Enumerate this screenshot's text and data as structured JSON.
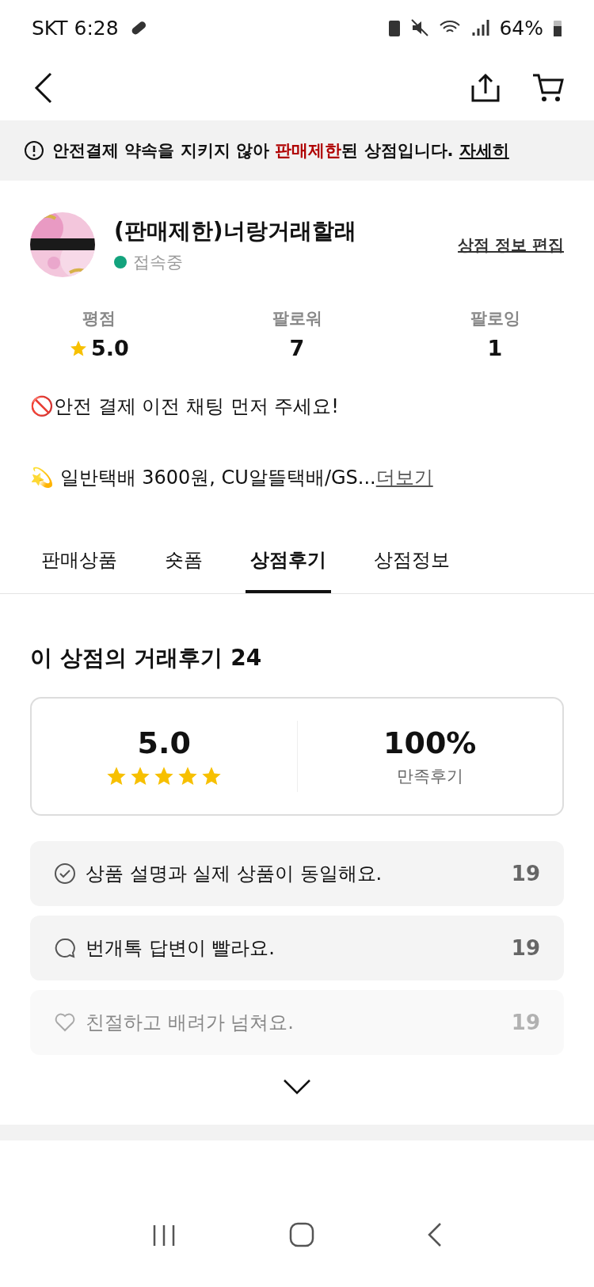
{
  "status_bar": {
    "carrier_time": "SKT 6:28",
    "battery": "64%"
  },
  "notice": {
    "segments": [
      {
        "text": "안전결제 약속을 지키지 않아 ",
        "kind": "plain"
      },
      {
        "text": "판매제한",
        "kind": "warning"
      },
      {
        "text": "된 상점입니다. ",
        "kind": "plain"
      }
    ],
    "link": "자세히"
  },
  "shop": {
    "name": "(판매제한)너랑거래할래",
    "online": true,
    "status": "접속중",
    "edit_link": "상점 정보 편집"
  },
  "stats": [
    {
      "label": "평점",
      "value": "5.0",
      "kind": "rating"
    },
    {
      "label": "팔로워",
      "value": "7",
      "kind": "count"
    },
    {
      "label": "팔로잉",
      "value": "1",
      "kind": "count"
    }
  ],
  "bio": [
    "🚫안전 결제 이전 채팅 먼저 주세요!",
    "💫 일반택배 3600원, CU알뜰택배/GS..."
  ],
  "bio_more": "더보기",
  "tabs": [
    {
      "label": "판매상품",
      "selected": false
    },
    {
      "label": "숏폼",
      "selected": false
    },
    {
      "label": "상점후기",
      "selected": true
    },
    {
      "label": "상점정보",
      "selected": false
    }
  ],
  "reviews": {
    "heading": "이 상점의 거래후기 24",
    "score": "5.0",
    "stars": 5,
    "satisfaction": "100%",
    "satisfaction_label": "만족후기",
    "items": [
      {
        "kind": "check",
        "text": "상품 설명과 실제 상품이 동일해요.",
        "count": "19",
        "faded": false
      },
      {
        "kind": "chat",
        "text": "번개톡 답변이 빨라요.",
        "count": "19",
        "faded": false
      },
      {
        "kind": "heart",
        "text": "친절하고 배려가 넘쳐요.",
        "count": "19",
        "faded": true
      }
    ]
  }
}
